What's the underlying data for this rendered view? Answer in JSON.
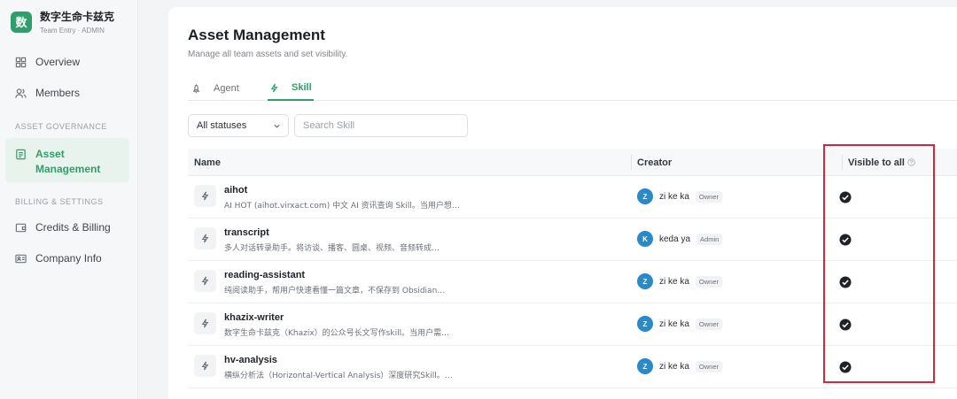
{
  "brand": {
    "logo_char": "数",
    "name": "数字生命卡兹克",
    "subtitle": "Team Entry · ADMIN"
  },
  "sidebar": {
    "items": [
      {
        "label": "Overview",
        "icon": "grid-icon"
      },
      {
        "label": "Members",
        "icon": "users-icon"
      }
    ],
    "section_asset": "ASSET GOVERNANCE",
    "asset_item": {
      "label": "Asset Management",
      "icon": "document-icon",
      "active": true
    },
    "section_billing": "BILLING & SETTINGS",
    "billing_items": [
      {
        "label": "Credits & Billing",
        "icon": "wallet-icon"
      },
      {
        "label": "Company Info",
        "icon": "id-card-icon"
      }
    ]
  },
  "main": {
    "title": "Asset Management",
    "description": "Manage all team assets and set visibility.",
    "tabs": [
      {
        "label": "Agent",
        "icon": "rocket-icon",
        "active": false
      },
      {
        "label": "Skill",
        "icon": "lightning-icon",
        "active": true
      }
    ],
    "filter": {
      "status_selected": "All statuses",
      "search_placeholder": "Search Skill"
    },
    "table": {
      "columns": [
        "Name",
        "Creator",
        "Visible to all"
      ],
      "rows": [
        {
          "name": "aihot",
          "description": "AI HOT (aihot.virxact.com) 中文 AI 资讯查询 Skill。当用户想…",
          "creator": "zi ke ka",
          "avatar": "Z",
          "role": "Owner",
          "visible": true
        },
        {
          "name": "transcript",
          "description": "多人对话转录助手。将访谈、播客、圆桌、视频、音频转成…",
          "creator": "keda ya",
          "avatar": "K",
          "role": "Admin",
          "visible": true
        },
        {
          "name": "reading-assistant",
          "description": "纯阅读助手，帮用户快速看懂一篇文章，不保存到 Obsidian…",
          "creator": "zi ke ka",
          "avatar": "Z",
          "role": "Owner",
          "visible": true
        },
        {
          "name": "khazix-writer",
          "description": "数字生命卡兹克（Khazix）的公众号长文写作skill。当用户需…",
          "creator": "zi ke ka",
          "avatar": "Z",
          "role": "Owner",
          "visible": true
        },
        {
          "name": "hv-analysis",
          "description": "横纵分析法（Horizontal-Vertical Analysis）深度研究Skill。…",
          "creator": "zi ke ka",
          "avatar": "Z",
          "role": "Owner",
          "visible": true
        }
      ]
    }
  },
  "colors": {
    "accent": "#2f9e6b",
    "avatar": "#2a8ac7",
    "highlight": "#d4283a"
  }
}
